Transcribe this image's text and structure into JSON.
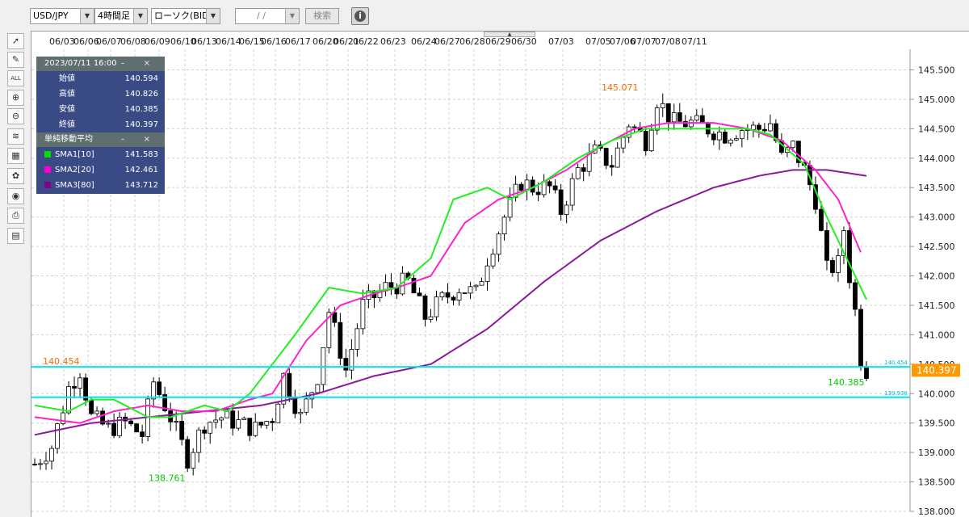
{
  "toolbar": {
    "pair": "USD/JPY",
    "interval": "4時間足",
    "chart_type": "ローソク(BID)",
    "date_placeholder": "/ /",
    "search_label": "検索",
    "info_label": "i"
  },
  "tools": [
    {
      "name": "pointer-tool",
      "glyph": "➚"
    },
    {
      "name": "pen-tool",
      "glyph": "✎"
    },
    {
      "name": "all-tool",
      "glyph": "ALL"
    },
    {
      "name": "zoom-in-tool",
      "glyph": "⊕"
    },
    {
      "name": "zoom-out-tool",
      "glyph": "⊖"
    },
    {
      "name": "indicator-tool",
      "glyph": "≋"
    },
    {
      "name": "data-tool",
      "glyph": "▦"
    },
    {
      "name": "palette-tool",
      "glyph": "✿"
    },
    {
      "name": "view-tool",
      "glyph": "◉"
    },
    {
      "name": "print-tool",
      "glyph": "⎙"
    },
    {
      "name": "calc-tool",
      "glyph": "▤"
    }
  ],
  "ohlc_panel": {
    "title": "2023/07/11 16:00",
    "controls": "– ×",
    "rows": [
      {
        "label": "始値",
        "value": "140.594"
      },
      {
        "label": "高値",
        "value": "140.826"
      },
      {
        "label": "安値",
        "value": "140.385"
      },
      {
        "label": "終値",
        "value": "140.397"
      }
    ]
  },
  "sma_panel": {
    "title": "単純移動平均",
    "controls": "– ×",
    "rows": [
      {
        "label": "SMA1[10]",
        "value": "141.583",
        "color": "#00e000"
      },
      {
        "label": "SMA2[20]",
        "value": "142.461",
        "color": "#ff00cc"
      },
      {
        "label": "SMA3[80]",
        "value": "143.712",
        "color": "#800090"
      }
    ]
  },
  "colors": {
    "sma1": "#22ee22",
    "sma2": "#ff22cc",
    "sma3": "#8a1a9a",
    "hline": "#00e5f0",
    "high_label": "#ff6600",
    "low_label": "#00cc00",
    "price_badge": "#ff9900"
  },
  "chart_data": {
    "type": "candlestick",
    "symbol": "USD/JPY",
    "x_tick_labels": [
      "06/03",
      "06/06",
      "06/07",
      "06/08",
      "06/09",
      "06/10",
      "06/13",
      "06/14",
      "06/15",
      "06/16",
      "06/17",
      "06/20",
      "06/21",
      "06/22",
      "06/23",
      "06/24",
      "06/27",
      "06/28",
      "06/29",
      "06/30",
      "07/03",
      "07/05",
      "07/06",
      "07/07",
      "07/08",
      "07/11"
    ],
    "y_ticks": [
      "145.500",
      "145.000",
      "144.500",
      "144.000",
      "143.500",
      "143.000",
      "142.500",
      "142.000",
      "141.500",
      "141.000",
      "140.500",
      "140.000",
      "139.500",
      "139.000",
      "138.500",
      "138.000"
    ],
    "y_range": [
      138.0,
      145.85
    ],
    "annotations": {
      "period_high": "145.071",
      "period_low": "138.761",
      "left_level": "140.454",
      "last_low": "140.385",
      "hline_upper": "140.454",
      "hline_lower": "139.938",
      "current_price": "140.397"
    },
    "hlines": [
      140.454,
      139.938
    ],
    "sma_anchors": {
      "sma1": [
        [
          0,
          139.8
        ],
        [
          6,
          139.7
        ],
        [
          10,
          139.9
        ],
        [
          14,
          139.9
        ],
        [
          20,
          139.6
        ],
        [
          24,
          139.6
        ],
        [
          30,
          139.8
        ],
        [
          34,
          139.7
        ],
        [
          38,
          140.0
        ],
        [
          42,
          140.5
        ],
        [
          46,
          141.0
        ],
        [
          52,
          141.8
        ],
        [
          58,
          141.7
        ],
        [
          64,
          141.8
        ],
        [
          70,
          142.3
        ],
        [
          74,
          143.3
        ],
        [
          80,
          143.5
        ],
        [
          84,
          143.3
        ],
        [
          90,
          143.6
        ],
        [
          96,
          144.0
        ],
        [
          102,
          144.3
        ],
        [
          108,
          144.5
        ],
        [
          114,
          144.5
        ],
        [
          120,
          144.5
        ],
        [
          126,
          144.5
        ],
        [
          130,
          144.4
        ],
        [
          136,
          143.9
        ],
        [
          140,
          143.0
        ],
        [
          144,
          142.2
        ],
        [
          147,
          141.6
        ]
      ],
      "sma2": [
        [
          0,
          139.6
        ],
        [
          8,
          139.5
        ],
        [
          14,
          139.7
        ],
        [
          20,
          139.8
        ],
        [
          26,
          139.7
        ],
        [
          32,
          139.7
        ],
        [
          38,
          139.9
        ],
        [
          42,
          140.0
        ],
        [
          48,
          140.9
        ],
        [
          54,
          141.5
        ],
        [
          60,
          141.7
        ],
        [
          64,
          141.8
        ],
        [
          70,
          142.0
        ],
        [
          76,
          142.9
        ],
        [
          82,
          143.3
        ],
        [
          88,
          143.5
        ],
        [
          94,
          143.8
        ],
        [
          100,
          144.2
        ],
        [
          106,
          144.5
        ],
        [
          112,
          144.6
        ],
        [
          120,
          144.6
        ],
        [
          126,
          144.5
        ],
        [
          132,
          144.3
        ],
        [
          138,
          143.8
        ],
        [
          142,
          143.3
        ],
        [
          146,
          142.4
        ]
      ],
      "sma3": [
        [
          0,
          139.3
        ],
        [
          10,
          139.5
        ],
        [
          20,
          139.6
        ],
        [
          30,
          139.7
        ],
        [
          40,
          139.8
        ],
        [
          50,
          140.0
        ],
        [
          60,
          140.3
        ],
        [
          70,
          140.5
        ],
        [
          80,
          141.1
        ],
        [
          90,
          141.9
        ],
        [
          100,
          142.6
        ],
        [
          110,
          143.1
        ],
        [
          120,
          143.5
        ],
        [
          128,
          143.7
        ],
        [
          134,
          143.8
        ],
        [
          140,
          143.8
        ],
        [
          147,
          143.7
        ]
      ]
    },
    "price_anchors": [
      [
        0,
        138.8
      ],
      [
        3,
        139.1
      ],
      [
        6,
        140.1
      ],
      [
        8,
        140.4
      ],
      [
        10,
        139.6
      ],
      [
        13,
        139.4
      ],
      [
        16,
        139.5
      ],
      [
        19,
        139.3
      ],
      [
        21,
        140.2
      ],
      [
        24,
        139.6
      ],
      [
        27,
        138.9
      ],
      [
        30,
        139.5
      ],
      [
        33,
        139.6
      ],
      [
        36,
        139.5
      ],
      [
        39,
        139.4
      ],
      [
        42,
        139.6
      ],
      [
        44,
        140.3
      ],
      [
        47,
        139.6
      ],
      [
        50,
        140.3
      ],
      [
        52,
        141.4
      ],
      [
        55,
        140.4
      ],
      [
        58,
        141.5
      ],
      [
        62,
        141.8
      ],
      [
        66,
        141.9
      ],
      [
        69,
        141.3
      ],
      [
        72,
        141.6
      ],
      [
        75,
        141.8
      ],
      [
        78,
        141.7
      ],
      [
        80,
        142.3
      ],
      [
        83,
        143.0
      ],
      [
        86,
        143.6
      ],
      [
        88,
        143.5
      ],
      [
        91,
        143.5
      ],
      [
        93,
        143.1
      ],
      [
        96,
        143.8
      ],
      [
        99,
        144.1
      ],
      [
        102,
        143.9
      ],
      [
        105,
        144.6
      ],
      [
        108,
        144.3
      ],
      [
        110,
        145.0
      ],
      [
        113,
        144.6
      ],
      [
        116,
        144.6
      ],
      [
        119,
        144.5
      ],
      [
        122,
        144.4
      ],
      [
        125,
        144.5
      ],
      [
        128,
        144.5
      ],
      [
        130,
        144.6
      ],
      [
        132,
        144.0
      ],
      [
        134,
        144.2
      ],
      [
        136,
        143.8
      ],
      [
        138,
        143.3
      ],
      [
        140,
        142.1
      ],
      [
        142,
        142.2
      ],
      [
        143,
        142.8
      ],
      [
        144,
        142.0
      ],
      [
        145,
        141.4
      ],
      [
        146,
        140.6
      ],
      [
        147,
        140.4
      ]
    ]
  }
}
